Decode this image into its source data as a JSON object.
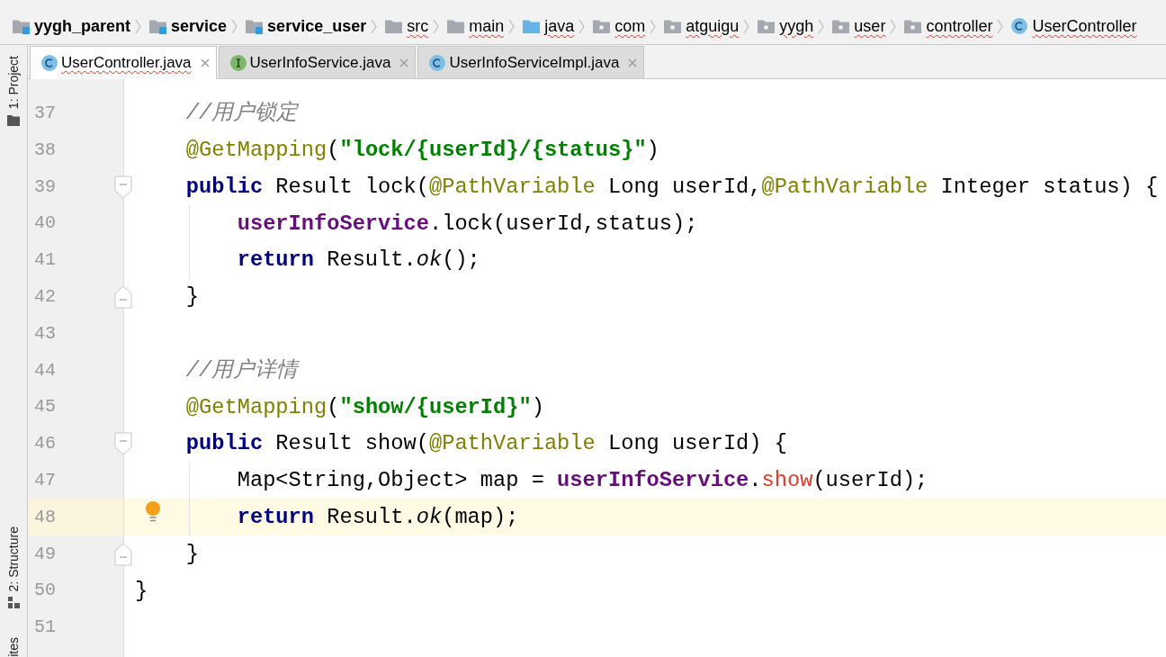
{
  "breadcrumbs": [
    {
      "label": "yygh_parent",
      "kind": "module",
      "misspelled": false
    },
    {
      "label": "service",
      "kind": "module",
      "misspelled": false
    },
    {
      "label": "service_user",
      "kind": "module",
      "misspelled": false
    },
    {
      "label": "src",
      "kind": "folder",
      "misspelled": true
    },
    {
      "label": "main",
      "kind": "folder",
      "misspelled": true
    },
    {
      "label": "java",
      "kind": "source_root",
      "misspelled": true
    },
    {
      "label": "com",
      "kind": "package",
      "misspelled": true
    },
    {
      "label": "atguigu",
      "kind": "package",
      "misspelled": true
    },
    {
      "label": "yygh",
      "kind": "package",
      "misspelled": true
    },
    {
      "label": "user",
      "kind": "package",
      "misspelled": true
    },
    {
      "label": "controller",
      "kind": "package",
      "misspelled": true
    },
    {
      "label": "UserController",
      "kind": "class",
      "misspelled": true
    }
  ],
  "tool_strip": {
    "top": [
      {
        "label": "1: Project",
        "kind": "project"
      }
    ],
    "bottom": [
      {
        "label": "2: Structure",
        "kind": "structure"
      },
      {
        "label": "ites",
        "kind": "label_only"
      }
    ]
  },
  "tabs": [
    {
      "label": "UserController.java",
      "kind": "class",
      "selected": true,
      "misspelled": true
    },
    {
      "label": "UserInfoService.java",
      "kind": "interface",
      "selected": false,
      "misspelled": false
    },
    {
      "label": "UserInfoServiceImpl.java",
      "kind": "class",
      "selected": false,
      "misspelled": false
    }
  ],
  "editor": {
    "lines": [
      {
        "number": "37",
        "current": false,
        "bulb": false,
        "fold_start": false,
        "fold_end": false,
        "tokens": [
          {
            "kind": "comment",
            "text": "    //用户锁定"
          }
        ]
      },
      {
        "number": "38",
        "current": false,
        "bulb": false,
        "fold_start": false,
        "fold_end": false,
        "tokens": [
          {
            "kind": "annotation",
            "text": "    @GetMapping"
          },
          {
            "kind": "plain",
            "text": "("
          },
          {
            "kind": "string",
            "text": "\"lock/{userId}/{status}\""
          },
          {
            "kind": "plain",
            "text": ")"
          }
        ]
      },
      {
        "number": "39",
        "current": false,
        "bulb": false,
        "fold_start": true,
        "fold_end": false,
        "tokens": [
          {
            "kind": "keyword",
            "text": "    public"
          },
          {
            "kind": "plain",
            "text": " Result lock("
          },
          {
            "kind": "annotation",
            "text": "@PathVariable"
          },
          {
            "kind": "plain",
            "text": " Long userId,"
          },
          {
            "kind": "annotation",
            "text": "@PathVariable"
          },
          {
            "kind": "plain",
            "text": " Integer status) {"
          }
        ]
      },
      {
        "number": "40",
        "current": false,
        "bulb": false,
        "fold_start": false,
        "fold_end": false,
        "tokens": [
          {
            "kind": "field",
            "text": "        userInfoService"
          },
          {
            "kind": "plain",
            "text": ".lock(userId,status);"
          }
        ]
      },
      {
        "number": "41",
        "current": false,
        "bulb": false,
        "fold_start": false,
        "fold_end": false,
        "tokens": [
          {
            "kind": "keyword",
            "text": "        return"
          },
          {
            "kind": "plain",
            "text": " Result."
          },
          {
            "kind": "static_call",
            "text": "ok"
          },
          {
            "kind": "plain",
            "text": "();"
          }
        ]
      },
      {
        "number": "42",
        "current": false,
        "bulb": false,
        "fold_start": false,
        "fold_end": true,
        "tokens": [
          {
            "kind": "plain",
            "text": "    }"
          }
        ]
      },
      {
        "number": "43",
        "current": false,
        "bulb": false,
        "fold_start": false,
        "fold_end": false
      },
      {
        "number": "44",
        "current": false,
        "bulb": false,
        "fold_start": false,
        "fold_end": false,
        "tokens": [
          {
            "kind": "comment",
            "text": "    //用户详情"
          }
        ]
      },
      {
        "number": "45",
        "current": false,
        "bulb": false,
        "fold_start": false,
        "fold_end": false,
        "tokens": [
          {
            "kind": "annotation",
            "text": "    @GetMapping"
          },
          {
            "kind": "plain",
            "text": "("
          },
          {
            "kind": "string",
            "text": "\"show/{userId}\""
          },
          {
            "kind": "plain",
            "text": ")"
          }
        ]
      },
      {
        "number": "46",
        "current": false,
        "bulb": false,
        "fold_start": true,
        "fold_end": false,
        "tokens": [
          {
            "kind": "keyword",
            "text": "    public"
          },
          {
            "kind": "plain",
            "text": " Result show("
          },
          {
            "kind": "annotation",
            "text": "@PathVariable"
          },
          {
            "kind": "plain",
            "text": " Long userId) {"
          }
        ]
      },
      {
        "number": "47",
        "current": false,
        "bulb": false,
        "fold_start": false,
        "fold_end": false,
        "tokens": [
          {
            "kind": "plain",
            "text": "        Map<String,Object> map = "
          },
          {
            "kind": "field",
            "text": "userInfoService"
          },
          {
            "kind": "plain",
            "text": "."
          },
          {
            "kind": "error_call",
            "text": "show"
          },
          {
            "kind": "plain",
            "text": "(userId);"
          }
        ]
      },
      {
        "number": "48",
        "current": true,
        "bulb": true,
        "fold_start": false,
        "fold_end": false,
        "tokens": [
          {
            "kind": "keyword",
            "text": "        return"
          },
          {
            "kind": "plain",
            "text": " Result."
          },
          {
            "kind": "static_call",
            "text": "ok"
          },
          {
            "kind": "plain",
            "text": "(map);"
          }
        ]
      },
      {
        "number": "49",
        "current": false,
        "bulb": false,
        "fold_start": false,
        "fold_end": true,
        "tokens": [
          {
            "kind": "plain",
            "text": "    }"
          }
        ]
      },
      {
        "number": "50",
        "current": false,
        "bulb": false,
        "fold_start": false,
        "fold_end": false,
        "tokens": [
          {
            "kind": "plain",
            "text": "}"
          }
        ]
      },
      {
        "number": "51",
        "current": false,
        "bulb": false,
        "fold_start": false,
        "fold_end": false
      }
    ]
  }
}
